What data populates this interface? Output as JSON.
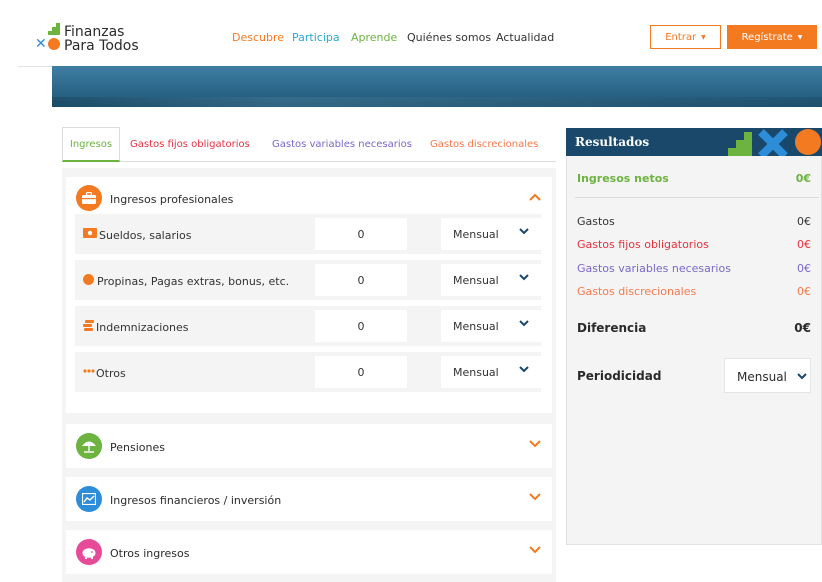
{
  "logo": {
    "line1": "Finanzas",
    "line2": "Para Todos"
  },
  "nav": {
    "descubre": "Descubre",
    "participa": "Participa",
    "aprende": "Aprende",
    "quienes": "Quiénes somos",
    "actualidad": "Actualidad"
  },
  "header": {
    "entrar": "Entrar",
    "registrate": "Regístrate",
    "caret": "▼"
  },
  "tabs": {
    "ingresos": "Ingresos",
    "fijos": "Gastos fijos obligatorios",
    "variables": "Gastos variables necesarios",
    "discrecionales": "Gastos discrecionales"
  },
  "section_main": {
    "title": "Ingresos profesionales",
    "rows": [
      {
        "label": "Sueldos, salarios",
        "value": "0",
        "period": "Mensual",
        "icon": "money-icon"
      },
      {
        "label": "Propinas, Pagas extras, bonus, etc.",
        "value": "0",
        "period": "Mensual",
        "icon": "coin-icon"
      },
      {
        "label": "Indemnizaciones",
        "value": "0",
        "period": "Mensual",
        "icon": "coins-stack-icon"
      },
      {
        "label": "Otros",
        "value": "0",
        "period": "Mensual",
        "icon": "dots-icon"
      }
    ]
  },
  "sections_collapsed": [
    {
      "title": "Pensiones",
      "icon": "umbrella-icon",
      "color": "#6cb33f"
    },
    {
      "title": "Ingresos financieros / inversión",
      "icon": "chart-icon",
      "color": "#2d8dd9"
    },
    {
      "title": "Otros ingresos",
      "icon": "piggy-bank-icon",
      "color": "#e84a9a"
    }
  ],
  "results": {
    "title": "Resultados",
    "ingresos_netos": {
      "label": "Ingresos netos",
      "value": "0€"
    },
    "gastos": {
      "label": "Gastos",
      "value": "0€"
    },
    "fijos": {
      "label": "Gastos fijos obligatorios",
      "value": "0€"
    },
    "variables": {
      "label": "Gastos variables necesarios",
      "value": "0€"
    },
    "discrecionales": {
      "label": "Gastos discrecionales",
      "value": "0€"
    },
    "diferencia": {
      "label": "Diferencia",
      "value": "0€"
    },
    "periodicidad": {
      "label": "Periodicidad",
      "value": "Mensual"
    }
  },
  "colors": {
    "brand_orange": "#f47a22",
    "green": "#6cb33f",
    "blue": "#2d8dd9",
    "navy": "#19486b",
    "red": "#e2343f",
    "purple": "#7b68c8",
    "salmon": "#f47a4a"
  }
}
